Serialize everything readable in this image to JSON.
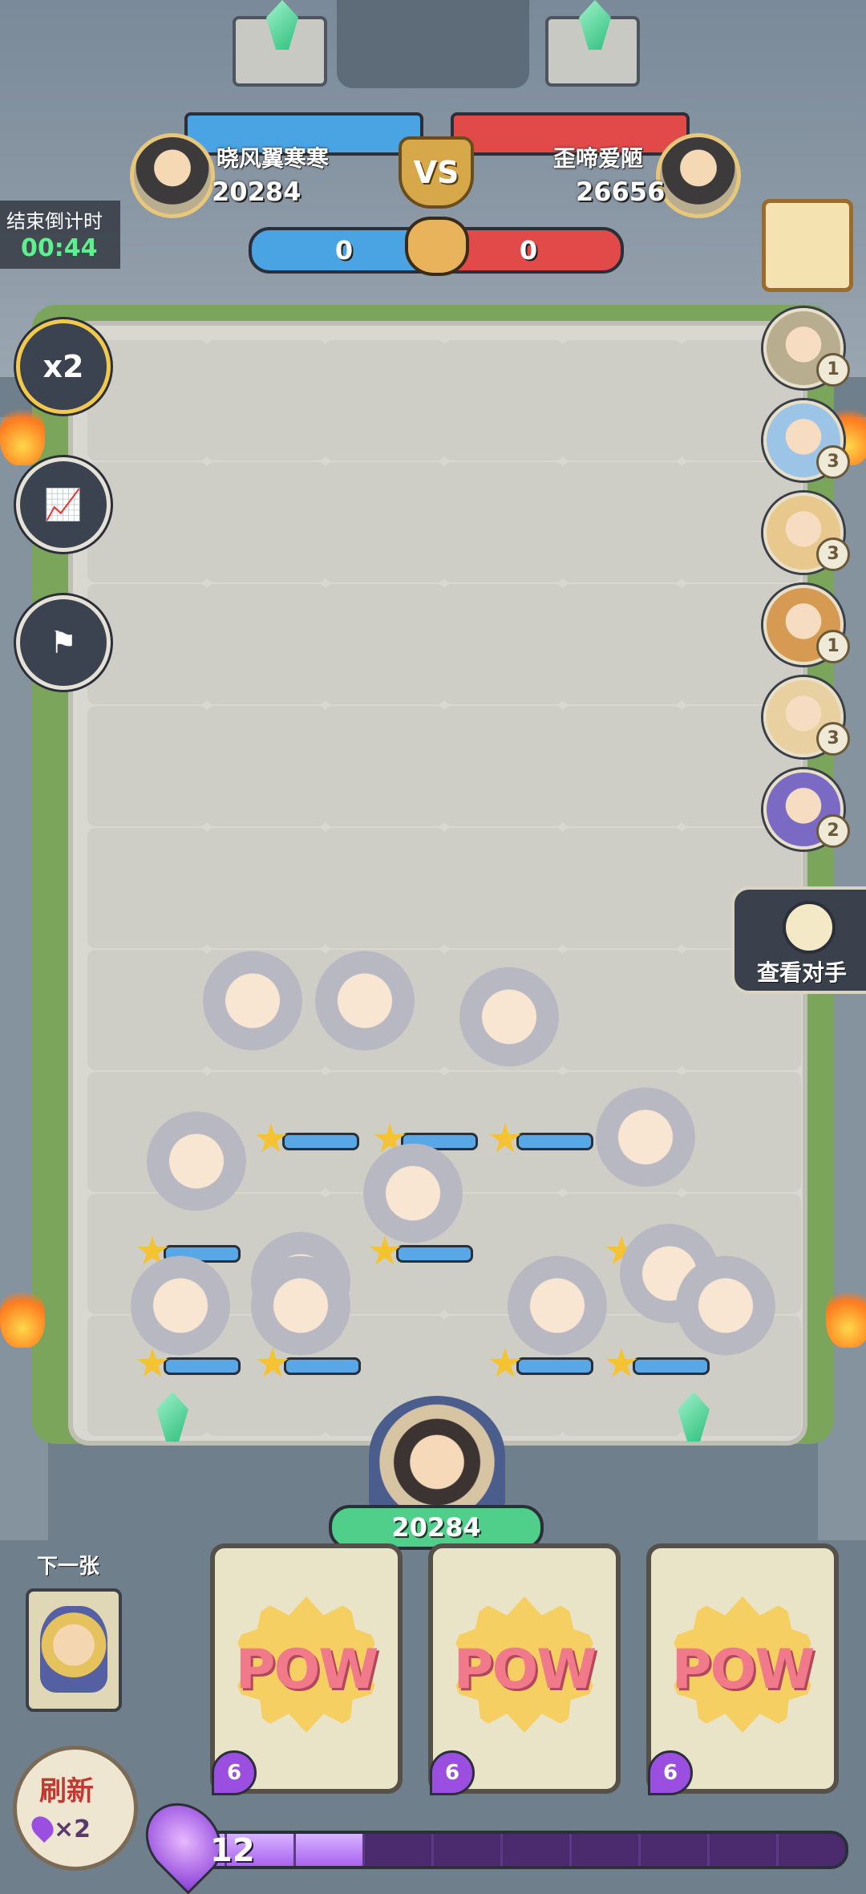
{
  "hud": {
    "left_player": {
      "name": "晓风翼寒寒",
      "score": "20284",
      "avatar_icon": "king-portrait-icon",
      "color": "#4aa3e2"
    },
    "right_player": {
      "name": "歪啼爱陋",
      "score": "26656",
      "avatar_icon": "king-portrait-icon",
      "color": "#e24a4a"
    },
    "vs_label": "VS",
    "left_kills": "0",
    "right_kills": "0"
  },
  "countdown": {
    "label": "结束倒计时",
    "time": "00:44"
  },
  "left_buttons": [
    {
      "name": "speed-x2-button",
      "label": "x2"
    },
    {
      "name": "stats-button",
      "label": "📈"
    },
    {
      "name": "surrender-flag-button",
      "label": "⚑"
    }
  ],
  "opponent_lineup": {
    "counts": [
      "1",
      "3",
      "3",
      "1",
      "3",
      "2"
    ],
    "view_button_label": "查看对手"
  },
  "units": [
    {
      "label": "swordsman-unit",
      "stars": 1,
      "bar_fill": 0.4
    },
    {
      "label": "swordsman-unit",
      "stars": 1,
      "bar_fill": 0.4
    },
    {
      "label": "monkey-king-unit",
      "stars": 1,
      "bar_fill": 0.4
    },
    {
      "label": "dwarf-hammer-unit",
      "stars": 1,
      "bar_fill": 0.4
    },
    {
      "label": "engineer-unit",
      "stars": 1,
      "bar_fill": 0.4
    },
    {
      "label": "dwarf-hammer-unit",
      "stars": 1,
      "bar_fill": 0.4
    },
    {
      "label": "dwarf-hammer-unit",
      "stars": 1,
      "bar_fill": 0.4
    },
    {
      "label": "engineer-unit",
      "stars": 1,
      "bar_fill": 0.4
    },
    {
      "label": "dwarf-hammer-unit",
      "stars": 1,
      "bar_fill": 0.4
    },
    {
      "label": "witch-unit",
      "stars": 1,
      "bar_fill": 0.4
    },
    {
      "label": "engineer-unit",
      "stars": 1,
      "bar_fill": 0.4
    },
    {
      "label": "engineer-unit",
      "stars": 1,
      "bar_fill": 0.4
    }
  ],
  "king": {
    "hp": "20284"
  },
  "hand": {
    "next_label": "下一张",
    "cards": [
      {
        "text": "POW",
        "cost": "6"
      },
      {
        "text": "POW",
        "cost": "6"
      },
      {
        "text": "POW",
        "cost": "6"
      }
    ]
  },
  "refresh": {
    "label": "刷新",
    "cost": "×2"
  },
  "energy": {
    "value": "12",
    "fill": 0.3,
    "max_segments": 10
  }
}
